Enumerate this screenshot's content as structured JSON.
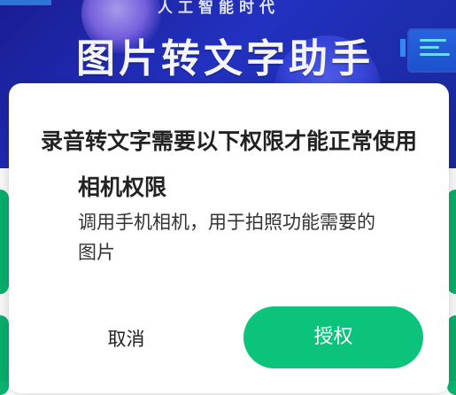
{
  "banner": {
    "subtitle": "人工智能时代",
    "title": "图片转文字助手"
  },
  "dialog": {
    "title": "录音转文字需要以下权限才能正常使用",
    "permission": {
      "name": "相机权限",
      "description": "调用手机相机，用于拍照功能需要的图片"
    },
    "cancel_label": "取消",
    "grant_label": "授权"
  },
  "colors": {
    "accent": "#0bc37a",
    "banner": "#2433c8"
  }
}
